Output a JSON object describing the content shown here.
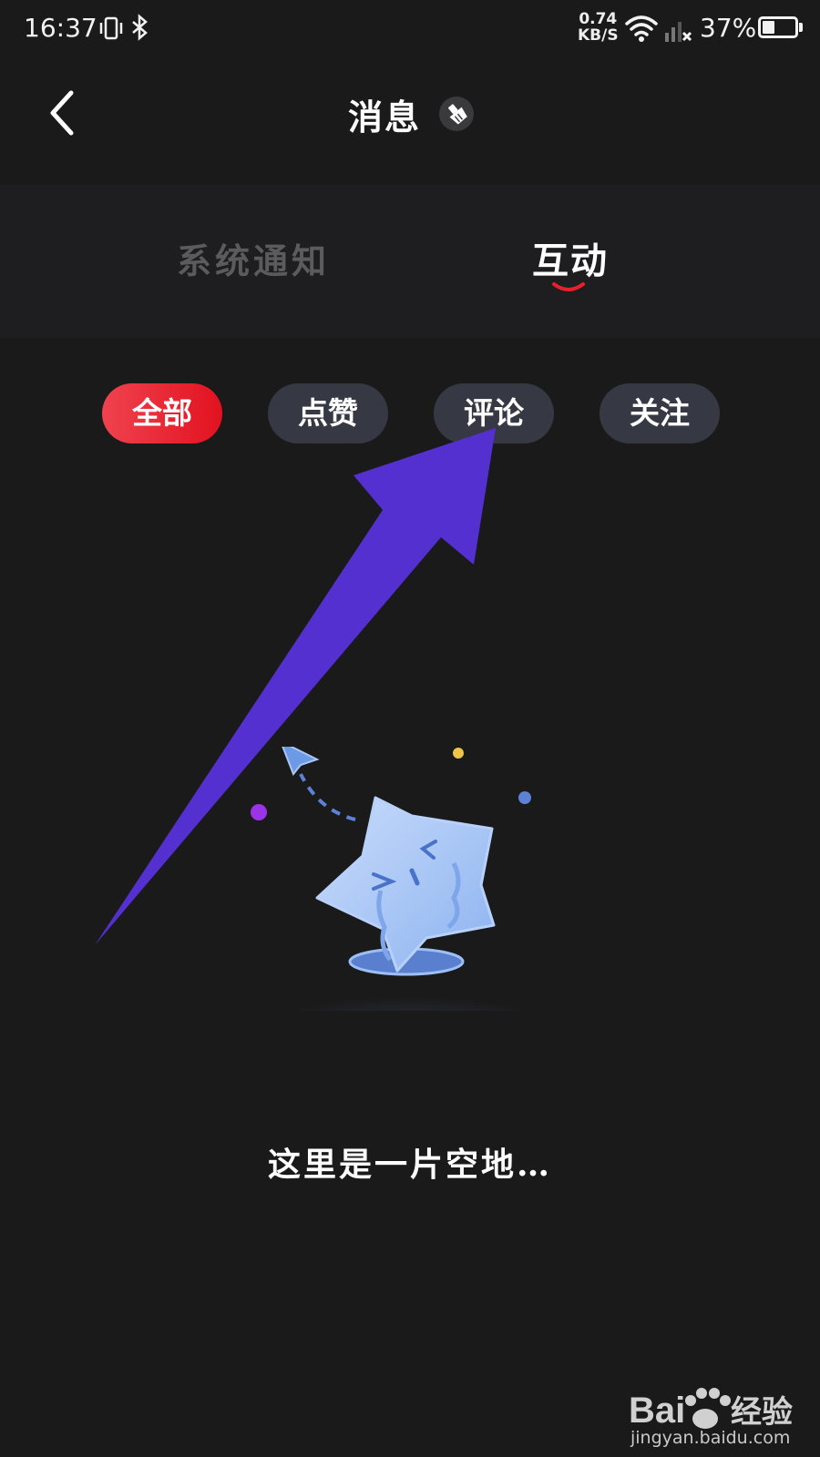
{
  "status_bar": {
    "time": "16:37",
    "net_speed_value": "0.74",
    "net_speed_unit": "KB/S",
    "battery_text": "37%",
    "battery_level": 0.37
  },
  "header": {
    "title": "消息"
  },
  "tabs": [
    {
      "label": "系统通知",
      "active": false
    },
    {
      "label": "互动",
      "active": true
    }
  ],
  "filters": [
    {
      "label": "全部",
      "active": true
    },
    {
      "label": "点赞",
      "active": false
    },
    {
      "label": "评论",
      "active": false
    },
    {
      "label": "关注",
      "active": false
    }
  ],
  "empty_state": {
    "message": "这里是一片空地…"
  },
  "watermark": {
    "brand": "Bai 经验",
    "url": "jingyan.baidu.com"
  },
  "colors": {
    "background": "#1a1a1b",
    "accent_red": "#e8202c",
    "chip_inactive": "#363943",
    "annotation_arrow": "#5530d0"
  }
}
